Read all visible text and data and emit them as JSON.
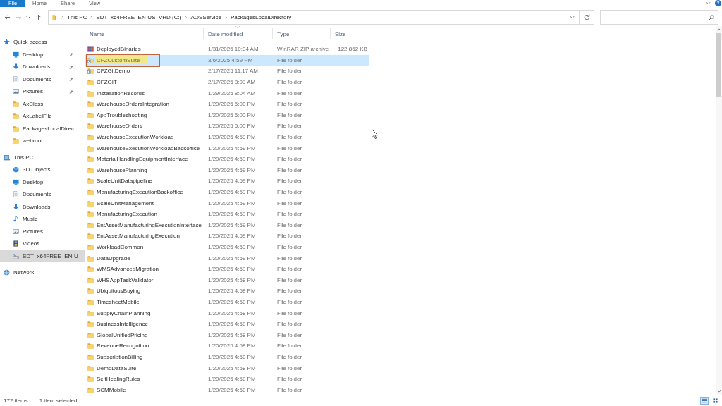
{
  "ribbon": {
    "tabs": [
      {
        "label": "File",
        "selected": true
      },
      {
        "label": "Home",
        "selected": false
      },
      {
        "label": "Share",
        "selected": false
      },
      {
        "label": "View",
        "selected": false
      }
    ]
  },
  "navigation": {
    "buttons": [
      {
        "kind": "back",
        "disabled": false
      },
      {
        "kind": "forward",
        "disabled": true
      },
      {
        "kind": "recent",
        "disabled": false
      },
      {
        "kind": "up",
        "disabled": false
      }
    ],
    "breadcrumbs": [
      "This PC",
      "SDT_x64FREE_EN-US_VHD (C:)",
      "AOSService",
      "PackagesLocalDirectory"
    ]
  },
  "sidebar": {
    "sections": [
      {
        "label": "Quick access",
        "kind": "quick",
        "selected": false,
        "items": [
          {
            "label": "Desktop",
            "kind": "desktop",
            "pinned": true,
            "selected": false
          },
          {
            "label": "Downloads",
            "kind": "downloads",
            "pinned": true,
            "selected": false
          },
          {
            "label": "Documents",
            "kind": "documents",
            "pinned": true,
            "selected": false
          },
          {
            "label": "Pictures",
            "kind": "pictures",
            "pinned": true,
            "selected": false
          },
          {
            "label": "AxClass",
            "kind": "folder",
            "pinned": false,
            "selected": false
          },
          {
            "label": "AxLabelFile",
            "kind": "folder",
            "pinned": false,
            "selected": false
          },
          {
            "label": "PackagesLocalDirec",
            "kind": "folder",
            "pinned": false,
            "selected": false
          },
          {
            "label": "webroot",
            "kind": "folder",
            "pinned": false,
            "selected": false
          }
        ]
      },
      {
        "label": "This PC",
        "kind": "pc",
        "selected": false,
        "items": [
          {
            "label": "3D Objects",
            "kind": "objects3d",
            "pinned": false,
            "selected": false
          },
          {
            "label": "Desktop",
            "kind": "desktop",
            "pinned": false,
            "selected": false
          },
          {
            "label": "Documents",
            "kind": "documents",
            "pinned": false,
            "selected": false
          },
          {
            "label": "Downloads",
            "kind": "downloads",
            "pinned": false,
            "selected": false
          },
          {
            "label": "Music",
            "kind": "music",
            "pinned": false,
            "selected": false
          },
          {
            "label": "Pictures",
            "kind": "pictures",
            "pinned": false,
            "selected": false
          },
          {
            "label": "Videos",
            "kind": "videos",
            "pinned": false,
            "selected": false
          },
          {
            "label": "SDT_x64FREE_EN-U",
            "kind": "drive",
            "pinned": false,
            "selected": true
          }
        ]
      },
      {
        "label": "Network",
        "kind": "network",
        "selected": false
      }
    ]
  },
  "table": {
    "columns": [
      {
        "label": "Name",
        "sorted": false
      },
      {
        "label": "Date modified",
        "sorted": true
      },
      {
        "label": "Type",
        "sorted": false
      },
      {
        "label": "Size",
        "sorted": false
      }
    ],
    "rows": [
      {
        "kind": "archive",
        "name": "DeployedBinaries",
        "date": "1/31/2025 10:34 AM",
        "type": "WinRAR ZIP archive",
        "size": "122,862 KB",
        "selected": false,
        "highlighted": false
      },
      {
        "kind": "shortcut",
        "name": "CFZCustomSuite",
        "date": "3/6/2025 4:59 PM",
        "type": "File folder",
        "selected": true,
        "highlighted": true
      },
      {
        "kind": "shortcut",
        "name": "CFZGitDemo",
        "date": "2/17/2025 11:17 AM",
        "type": "File folder",
        "selected": false,
        "highlighted": false
      },
      {
        "kind": "folder",
        "name": "CFZGIT",
        "date": "2/17/2025 8:09 AM",
        "type": "File folder",
        "selected": false,
        "highlighted": false
      },
      {
        "kind": "folder",
        "name": "InstallationRecords",
        "date": "1/29/2025 8:04 AM",
        "type": "File folder",
        "selected": false,
        "highlighted": false
      },
      {
        "kind": "folder",
        "name": "WarehouseOrdersIntegration",
        "date": "1/20/2025 5:00 PM",
        "type": "File folder",
        "selected": false,
        "highlighted": false
      },
      {
        "kind": "folder",
        "name": "AppTroubleshooting",
        "date": "1/20/2025 5:00 PM",
        "type": "File folder",
        "selected": false,
        "highlighted": false
      },
      {
        "kind": "folder",
        "name": "WarehouseOrders",
        "date": "1/20/2025 5:00 PM",
        "type": "File folder",
        "selected": false,
        "highlighted": false
      },
      {
        "kind": "folder",
        "name": "WarehouseExecutionWorkload",
        "date": "1/20/2025 4:59 PM",
        "type": "File folder",
        "selected": false,
        "highlighted": false
      },
      {
        "kind": "folder",
        "name": "WarehouseExecutionWorkloadBackoffice",
        "date": "1/20/2025 4:59 PM",
        "type": "File folder",
        "selected": false,
        "highlighted": false
      },
      {
        "kind": "folder",
        "name": "MaterialHandlingEquipmentInterface",
        "date": "1/20/2025 4:59 PM",
        "type": "File folder",
        "selected": false,
        "highlighted": false
      },
      {
        "kind": "folder",
        "name": "WarehousePlanning",
        "date": "1/20/2025 4:59 PM",
        "type": "File folder",
        "selected": false,
        "highlighted": false
      },
      {
        "kind": "folder",
        "name": "ScaleUnitDatapipeline",
        "date": "1/20/2025 4:59 PM",
        "type": "File folder",
        "selected": false,
        "highlighted": false
      },
      {
        "kind": "folder",
        "name": "ManufacturingExecutionBackoffice",
        "date": "1/20/2025 4:59 PM",
        "type": "File folder",
        "selected": false,
        "highlighted": false
      },
      {
        "kind": "folder",
        "name": "ScaleUnitManagement",
        "date": "1/20/2025 4:59 PM",
        "type": "File folder",
        "selected": false,
        "highlighted": false
      },
      {
        "kind": "folder",
        "name": "ManufacturingExecution",
        "date": "1/20/2025 4:59 PM",
        "type": "File folder",
        "selected": false,
        "highlighted": false
      },
      {
        "kind": "folder",
        "name": "EntAssetManufacturingExecutionInterface",
        "date": "1/20/2025 4:59 PM",
        "type": "File folder",
        "selected": false,
        "highlighted": false
      },
      {
        "kind": "folder",
        "name": "EntAssetManufacturingExecution",
        "date": "1/20/2025 4:59 PM",
        "type": "File folder",
        "selected": false,
        "highlighted": false
      },
      {
        "kind": "folder",
        "name": "WorkloadCommon",
        "date": "1/20/2025 4:59 PM",
        "type": "File folder",
        "selected": false,
        "highlighted": false
      },
      {
        "kind": "folder",
        "name": "DataUpgrade",
        "date": "1/20/2025 4:59 PM",
        "type": "File folder",
        "selected": false,
        "highlighted": false
      },
      {
        "kind": "folder",
        "name": "WMSAdvancedMigration",
        "date": "1/20/2025 4:59 PM",
        "type": "File folder",
        "selected": false,
        "highlighted": false
      },
      {
        "kind": "folder",
        "name": "WHSAppTaskValidator",
        "date": "1/20/2025 4:58 PM",
        "type": "File folder",
        "selected": false,
        "highlighted": false
      },
      {
        "kind": "folder",
        "name": "UbiquitousBuying",
        "date": "1/20/2025 4:58 PM",
        "type": "File folder",
        "selected": false,
        "highlighted": false
      },
      {
        "kind": "folder",
        "name": "TimesheetMobile",
        "date": "1/20/2025 4:58 PM",
        "type": "File folder",
        "selected": false,
        "highlighted": false
      },
      {
        "kind": "folder",
        "name": "SupplyChainPlanning",
        "date": "1/20/2025 4:58 PM",
        "type": "File folder",
        "selected": false,
        "highlighted": false
      },
      {
        "kind": "folder",
        "name": "BusinessIntelligence",
        "date": "1/20/2025 4:58 PM",
        "type": "File folder",
        "selected": false,
        "highlighted": false
      },
      {
        "kind": "folder",
        "name": "GlobalUnifiedPricing",
        "date": "1/20/2025 4:58 PM",
        "type": "File folder",
        "selected": false,
        "highlighted": false
      },
      {
        "kind": "folder",
        "name": "RevenueRecognition",
        "date": "1/20/2025 4:58 PM",
        "type": "File folder",
        "selected": false,
        "highlighted": false
      },
      {
        "kind": "folder",
        "name": "SubscriptionBilling",
        "date": "1/20/2025 4:58 PM",
        "type": "File folder",
        "selected": false,
        "highlighted": false
      },
      {
        "kind": "folder",
        "name": "DemoDataSuite",
        "date": "1/20/2025 4:58 PM",
        "type": "File folder",
        "selected": false,
        "highlighted": false
      },
      {
        "kind": "folder",
        "name": "SelfHealingRules",
        "date": "1/20/2025 4:58 PM",
        "type": "File folder",
        "selected": false,
        "highlighted": false
      },
      {
        "kind": "folder",
        "name": "SCMMobile",
        "date": "1/20/2025 4:58 PM",
        "type": "File folder",
        "selected": false,
        "highlighted": false
      }
    ]
  },
  "status_bar": {
    "item_count": "172 items",
    "selection": "1 item selected",
    "views": [
      {
        "kind": "details",
        "selected": true
      },
      {
        "kind": "large_icons",
        "selected": false
      }
    ]
  }
}
